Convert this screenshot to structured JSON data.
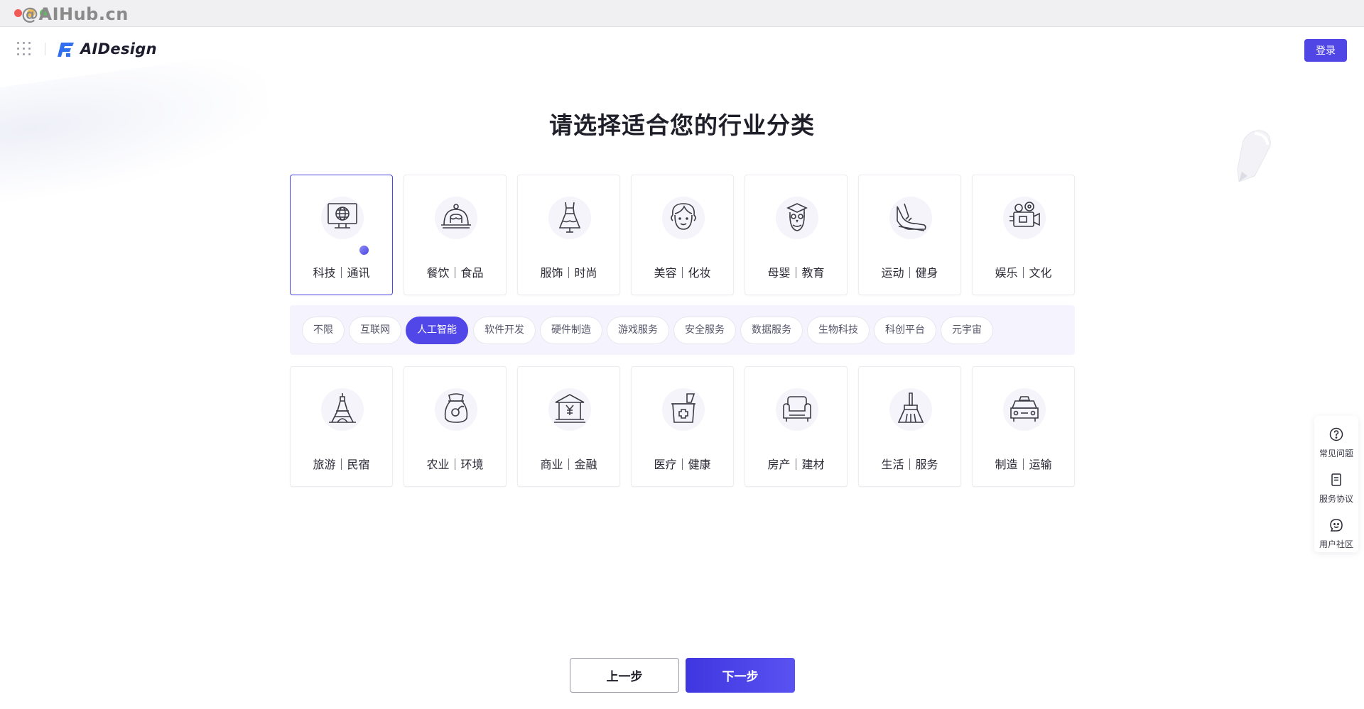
{
  "watermark": "@AIHub.cn",
  "header": {
    "logo_text": "AIDesign",
    "login_label": "登录",
    "apps_icon": "grid-dots-icon"
  },
  "page_title": "请选择适合您的行业分类",
  "categories_top": [
    {
      "label": "科技｜通讯",
      "icon": "monitor-globe-icon",
      "selected": true
    },
    {
      "label": "餐饮｜食品",
      "icon": "food-cloche-icon",
      "selected": false
    },
    {
      "label": "服饰｜时尚",
      "icon": "dress-icon",
      "selected": false
    },
    {
      "label": "美容｜化妆",
      "icon": "woman-face-icon",
      "selected": false
    },
    {
      "label": "母婴｜教育",
      "icon": "owl-graduate-icon",
      "selected": false
    },
    {
      "label": "运动｜健身",
      "icon": "sneaker-icon",
      "selected": false
    },
    {
      "label": "娱乐｜文化",
      "icon": "video-camera-icon",
      "selected": false
    }
  ],
  "subcategories": [
    {
      "label": "不限",
      "active": false
    },
    {
      "label": "互联网",
      "active": false
    },
    {
      "label": "人工智能",
      "active": true
    },
    {
      "label": "软件开发",
      "active": false
    },
    {
      "label": "硬件制造",
      "active": false
    },
    {
      "label": "游戏服务",
      "active": false
    },
    {
      "label": "安全服务",
      "active": false
    },
    {
      "label": "数据服务",
      "active": false
    },
    {
      "label": "生物科技",
      "active": false
    },
    {
      "label": "科创平台",
      "active": false
    },
    {
      "label": "元宇宙",
      "active": false
    }
  ],
  "categories_bottom": [
    {
      "label": "旅游｜民宿",
      "icon": "eiffel-tower-icon"
    },
    {
      "label": "农业｜环境",
      "icon": "seed-bag-icon"
    },
    {
      "label": "商业｜金融",
      "icon": "bank-yuan-icon"
    },
    {
      "label": "医疗｜健康",
      "icon": "medical-kit-icon"
    },
    {
      "label": "房产｜建材",
      "icon": "sofa-icon"
    },
    {
      "label": "生活｜服务",
      "icon": "broom-icon"
    },
    {
      "label": "制造｜运输",
      "icon": "car-icon"
    }
  ],
  "side_panel": [
    {
      "label": "常见问题",
      "icon": "question-circle-icon"
    },
    {
      "label": "服务协议",
      "icon": "document-icon"
    },
    {
      "label": "用户社区",
      "icon": "smile-chat-icon"
    }
  ],
  "buttons": {
    "prev_label": "上一步",
    "next_label": "下一步"
  },
  "colors": {
    "accent": "#4f46e5",
    "tag_panel_bg": "#f5f4fe",
    "icon_stroke": "#3b3b46"
  }
}
